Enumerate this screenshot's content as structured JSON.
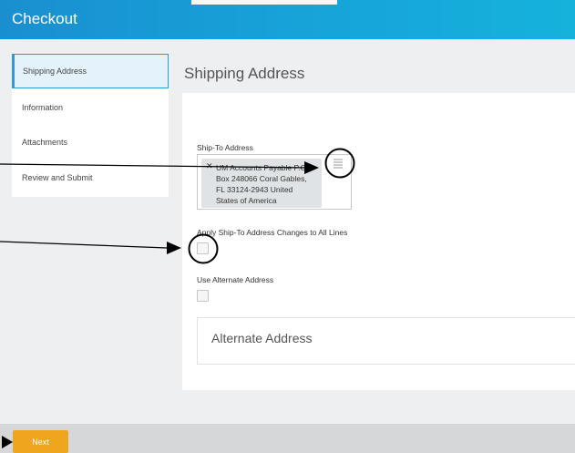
{
  "header": {
    "title": "Checkout"
  },
  "sidebar": {
    "items": [
      {
        "label": "Shipping Address",
        "active": true
      },
      {
        "label": "Information",
        "active": false
      },
      {
        "label": "Attachments",
        "active": false
      },
      {
        "label": "Review and Submit",
        "active": false
      }
    ]
  },
  "main": {
    "section_title": "Shipping Address",
    "ship_to": {
      "label": "Ship-To Address",
      "remove_glyph": "✕",
      "value_lines": [
        "UM Accounts Payable P.O.",
        "Box 248066 Coral Gables,",
        "FL 33124-2943 United",
        "States of America"
      ],
      "list_icon": "list-icon"
    },
    "apply_changes": {
      "label": "Apply Ship-To Address Changes to All Lines",
      "checked": false
    },
    "alternate": {
      "label": "Use Alternate Address",
      "checked": false,
      "panel_title": "Alternate Address"
    }
  },
  "footer": {
    "next_label": "Next"
  },
  "colors": {
    "header_start": "#1a8fd0",
    "header_end": "#15b2dc",
    "accent": "#2c9bd6",
    "next_button": "#f0a51f",
    "annotation": "#000000"
  }
}
